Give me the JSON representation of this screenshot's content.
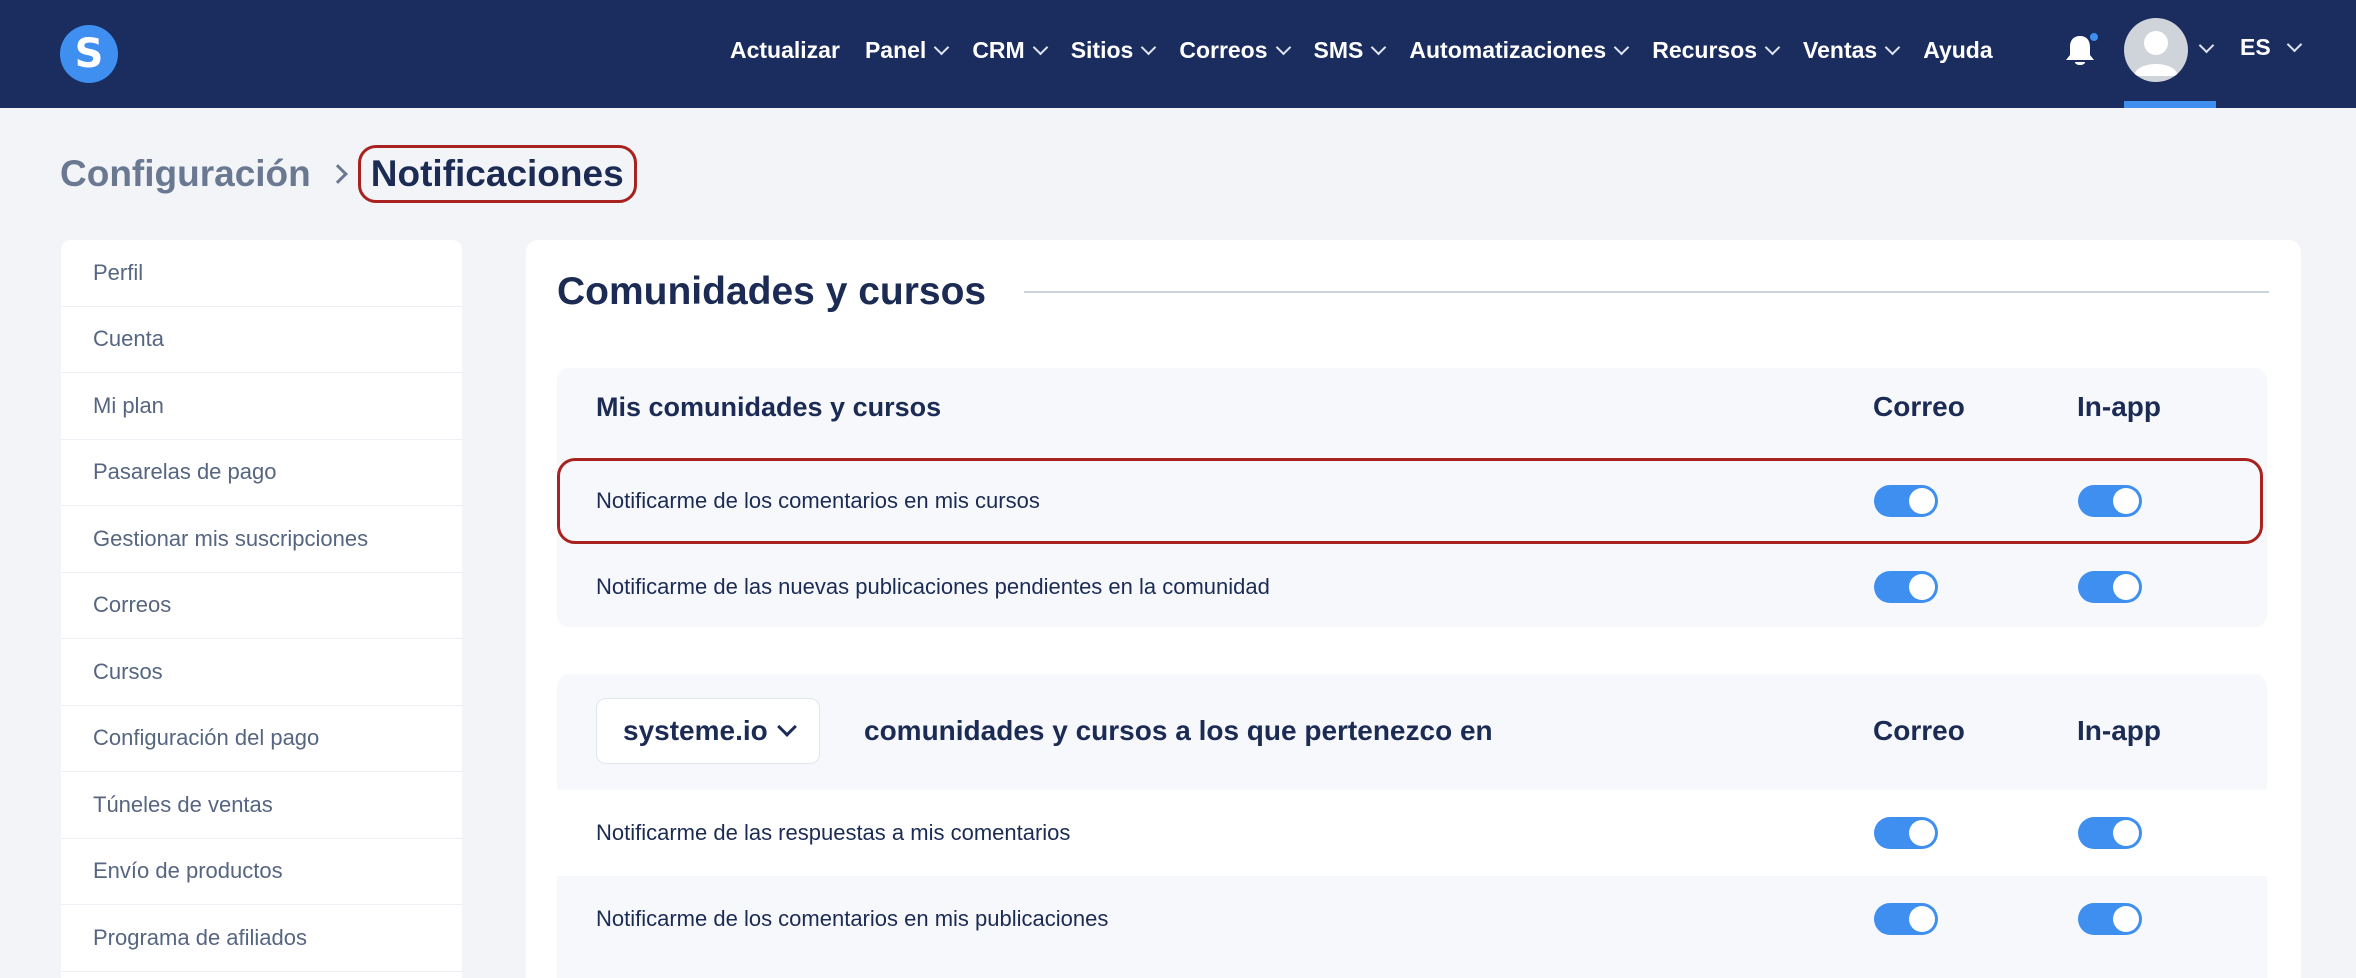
{
  "app": {
    "logo_letter": "S"
  },
  "nav": {
    "items": [
      {
        "label": "Actualizar",
        "has_dropdown": false
      },
      {
        "label": "Panel",
        "has_dropdown": true
      },
      {
        "label": "CRM",
        "has_dropdown": true
      },
      {
        "label": "Sitios",
        "has_dropdown": true
      },
      {
        "label": "Correos",
        "has_dropdown": true
      },
      {
        "label": "SMS",
        "has_dropdown": true
      },
      {
        "label": "Automatizaciones",
        "has_dropdown": true
      },
      {
        "label": "Recursos",
        "has_dropdown": true
      },
      {
        "label": "Ventas",
        "has_dropdown": true
      },
      {
        "label": "Ayuda",
        "has_dropdown": false
      }
    ],
    "notification_icon": "bell-icon",
    "language": "ES"
  },
  "breadcrumb": {
    "parent": "Configuración",
    "current": "Notificaciones"
  },
  "sidebar": {
    "items": [
      "Perfil",
      "Cuenta",
      "Mi plan",
      "Pasarelas de pago",
      "Gestionar mis suscripciones",
      "Correos",
      "Cursos",
      "Configuración del pago",
      "Túneles de ventas",
      "Envío de productos",
      "Programa de afiliados"
    ]
  },
  "main": {
    "section_title": "Comunidades y cursos",
    "panel1": {
      "title": "Mis comunidades y cursos",
      "col_email": "Correo",
      "col_inapp": "In-app",
      "rows": [
        {
          "label": "Notificarme de los comentarios en mis cursos",
          "email": true,
          "inapp": true
        },
        {
          "label": "Notificarme de las nuevas publicaciones pendientes en la comunidad",
          "email": true,
          "inapp": true
        }
      ]
    },
    "panel2": {
      "dropdown_value": "systeme.io",
      "title": "comunidades y cursos a los que pertenezco en",
      "col_email": "Correo",
      "col_inapp": "In-app",
      "rows": [
        {
          "label": "Notificarme de las respuestas a mis comentarios",
          "email": true,
          "inapp": true
        },
        {
          "label": "Notificarme de los comentarios en mis publicaciones",
          "email": true,
          "inapp": true
        }
      ]
    }
  },
  "colors": {
    "nav_bg": "#1b2d5e",
    "accent": "#3f8ff0",
    "highlight": "#a8221f",
    "text_dark": "#1b2b54"
  }
}
